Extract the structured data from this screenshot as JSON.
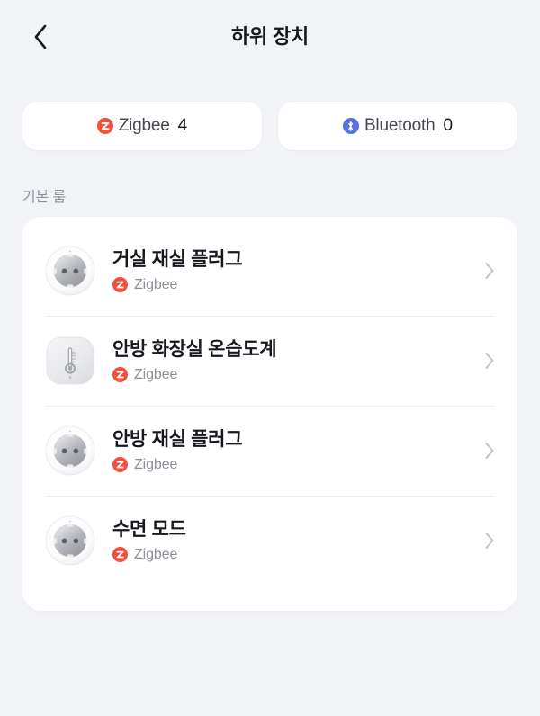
{
  "header": {
    "back_icon": "chevron-left-icon",
    "title": "하위 장치"
  },
  "protocol_tabs": [
    {
      "icon": "zigbee-icon",
      "label": "Zigbee",
      "count": "4",
      "accent_color": "#f0503c"
    },
    {
      "icon": "bluetooth-icon",
      "label": "Bluetooth",
      "count": "0",
      "accent_color": "#5871e0"
    }
  ],
  "section": {
    "title": "기본 룸"
  },
  "devices": [
    {
      "icon": "smart-plug-icon",
      "name": "거실 재실 플러그",
      "protocol": "Zigbee",
      "chevron": "chevron-right-icon"
    },
    {
      "icon": "thermo-hygrometer-icon",
      "name": "안방 화장실 온습도계",
      "protocol": "Zigbee",
      "chevron": "chevron-right-icon"
    },
    {
      "icon": "smart-plug-icon",
      "name": "안방 재실 플러그",
      "protocol": "Zigbee",
      "chevron": "chevron-right-icon"
    },
    {
      "icon": "smart-plug-icon",
      "name": "수면 모드",
      "protocol": "Zigbee",
      "chevron": "chevron-right-icon"
    }
  ],
  "colors": {
    "background": "#f2f3f7",
    "card": "#ffffff",
    "text_primary": "#16181d",
    "text_secondary": "#8d9099",
    "divider": "#eceef2"
  }
}
